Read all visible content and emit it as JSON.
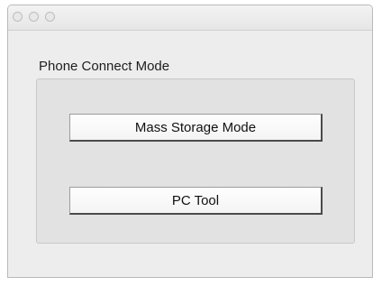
{
  "window": {
    "title": ""
  },
  "group": {
    "label": "Phone Connect Mode"
  },
  "buttons": {
    "mass_storage": "Mass Storage Mode",
    "pc_tool": "PC Tool"
  },
  "icons": {
    "close": "close-icon",
    "minimize": "minimize-icon",
    "zoom": "zoom-icon"
  },
  "colors": {
    "window_bg": "#ededed",
    "group_bg": "#e2e2e2",
    "button_bg": "#f8f8f8",
    "traffic_light": "#e8e8e8"
  }
}
